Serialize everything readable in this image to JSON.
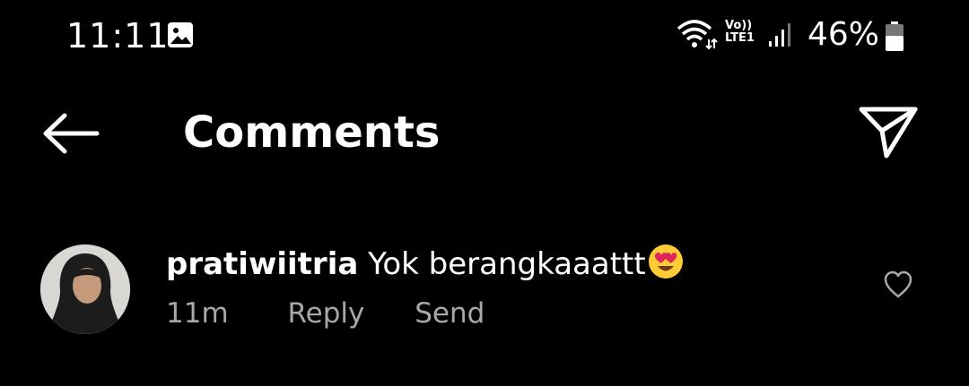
{
  "status_bar": {
    "time": "11:11",
    "network_label": "Vo))\nLTE1",
    "battery_percent": "46%",
    "battery_level": 0.46,
    "icons": [
      "gallery-icon",
      "wifi-icon",
      "signal-icon",
      "battery-icon"
    ]
  },
  "header": {
    "title": "Comments",
    "back_icon": "arrow-left-icon",
    "share_icon": "paper-plane-icon"
  },
  "comments": [
    {
      "username": "pratiwiitria",
      "text": "Yok berangkaaattt",
      "emoji": "heart-eyes-emoji",
      "timestamp": "11m",
      "reply_label": "Reply",
      "send_label": "Send",
      "liked": false
    }
  ],
  "colors": {
    "background": "#000000",
    "primary_text": "#ffffff",
    "secondary_text": "#a8a8a8"
  }
}
